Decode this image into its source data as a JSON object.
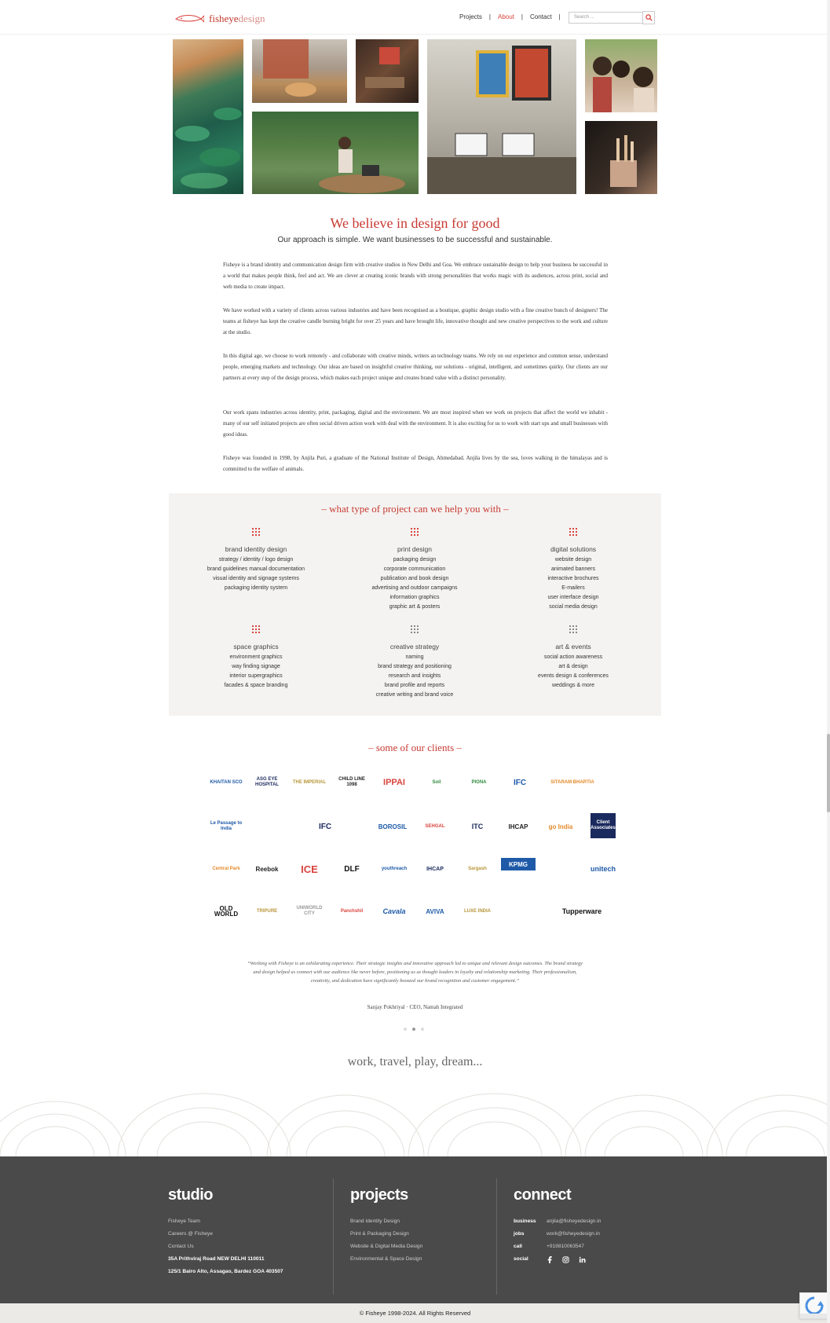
{
  "header": {
    "logo_bold": "fisheye",
    "logo_light": "design",
    "nav": [
      "Projects",
      "About",
      "Contact"
    ],
    "active_nav": "About",
    "search_placeholder": "Search ..."
  },
  "intro": {
    "headline": "We believe in design for good",
    "subhead": "Our approach is simple. We want businesses to be successful and sustainable.",
    "paragraphs": [
      "Fisheye is a brand identity and communication design firm with creative studios in New Delhi and Goa. We embrace sustainable design to help your business be successful in a world that makes people think, feel and act. We are clever at creating iconic brands with strong personalities that works magic with its audiences, across print, social and web media to create impact.",
      "We have worked with a variety of clients across various industries and have been recognised as a boutique, graphic design studio with a fine creative bunch of designers! The teams at fisheye has kept the creative candle burning bright for over 25 years and have brought life, innovative thought and new creative perspectives to the work and culture at the studio.",
      "In this digital age, we choose to work remotely - and collaborate with creative minds, writers an technology teams. We rely on our experience and common sense, understand people, emerging markets and technology. Our ideas are based on insightful creative thinking, our solutions - original, intelligent, and sometimes quirky. Our clients are our partners at every step of the design process, which makes each project unique and creates brand value with a distinct personality.",
      "Our work spans industries across identity, print, packaging, digital and the environment. We are most inspired when we work on projects that affect the world we inhabit - many of our self initiated projects are often social driven action work with deal with the environment. It is also exciting for us to work with start ups and small businesses with good ideas.",
      "Fisheye was founded in 1998, by Anjila Puri, a graduate of the National Institute of Design, Ahmedabad. Anjila lives by the sea, loves walking in the himalayas and is committed to the welfare of animals."
    ]
  },
  "services": {
    "title": "– what type of project can we help you with –",
    "items": [
      {
        "title": "brand identity design",
        "lines": [
          "strategy / identity / logo design",
          "brand guidelines manual documentation",
          "visual identity and signage systems",
          "packaging identity system"
        ]
      },
      {
        "title": "print design",
        "lines": [
          "packaging design",
          "corporate communication",
          "publication and book design",
          "advertising and outdoor campaigns",
          "information graphics",
          "graphic art & posters"
        ]
      },
      {
        "title": "digital solutions",
        "lines": [
          "website design",
          "animated banners",
          "interactive brochures",
          "E-mailers",
          "user interface design",
          "social media design"
        ]
      },
      {
        "title": "space graphics",
        "lines": [
          "environment graphics",
          "way finding signage",
          "interior supergraphics",
          "facades & space branding"
        ]
      },
      {
        "title": "creative strategy",
        "lines": [
          "naming",
          "brand strategy and positioning",
          "research and insights",
          "brand profile and reports",
          "creative writing and brand voice"
        ]
      },
      {
        "title": "art & events",
        "lines": [
          "social action awareness",
          "art & design",
          "events design & conferences",
          "weddings & more"
        ]
      }
    ]
  },
  "clients": {
    "title": "– some of our clients –",
    "logos": [
      [
        "KHAITAN SCO",
        "ASG EYE HOSPITAL",
        "THE IMPERIAL",
        "CHILD LINE 1098",
        "IPPAI",
        "Soil",
        "PIONA",
        "IFC",
        "SITARAM BHARTIA"
      ],
      [
        "Le Passage to India",
        "",
        "IFC",
        "BOROSIL",
        "SEHGAL",
        "ITC",
        "IHCAP",
        "go India",
        "Client Associates"
      ],
      [
        "Central Park",
        "Reebok",
        "ICE",
        "DLF",
        "youthreach",
        "IHCAP",
        "Sargash",
        "KPMG",
        "",
        "unitech"
      ],
      [
        "OLD WORLD",
        "TRIPURE",
        "UNIWORLD CITY",
        "Panchshil",
        "Cavala",
        "AVIVA",
        "LUXE INDIA",
        "",
        "Tupperware"
      ]
    ],
    "logo_colors": {
      "red": "#d9433c",
      "blue": "#1e5aa8",
      "navy": "#1b2a5e",
      "dark": "#222222",
      "orange": "#e58a2b",
      "green": "#2f8a3c",
      "gold": "#b8963a"
    }
  },
  "testimonial": {
    "quote": "“Working with Fisheye is an exhilarating experience. Their strategic insights and innovative approach led to unique and relevant design outcomes. The brand strategy and design helped us connect with our audience like never before, positioning us as thought leaders in loyalty and relationship marketing. Their professionalism, creativity, and dedication have significantly boosted our brand recognition and customer engagement.”",
    "author": "Sanjay Pokhriyal · CEO, Namah Integrated",
    "active_slide": 2
  },
  "tagline": "work, travel, play, dream...",
  "footer": {
    "studio": {
      "heading": "studio",
      "links": [
        "Fisheye Team",
        "Careers @ Fisheye",
        "Contact Us"
      ],
      "address1": "35A Prithviraj Road NEW DELHI 110011",
      "address2": "125/1 Bairo Alto, Assagao, Bardez GOA 403507"
    },
    "projects": {
      "heading": "projects",
      "links": [
        "Brand Identity Design",
        "Print & Packaging Design",
        "Website & Digital Media Design",
        "Environmental & Space Design"
      ]
    },
    "connect": {
      "heading": "connect",
      "rows": [
        {
          "k": "business",
          "v": "anjila@fisheyedesign.in"
        },
        {
          "k": "jobs",
          "v": "work@fisheyedesign.in"
        },
        {
          "k": "call",
          "v": "+919810063547"
        },
        {
          "k": "social",
          "v": ""
        }
      ],
      "social_icons": [
        "facebook-icon",
        "instagram-icon",
        "linkedin-icon"
      ]
    },
    "copyright": "© Fisheye 1998-2024. All Rights Reserved"
  },
  "colors": {
    "accent": "#c83a33",
    "footer_bg": "#4a4a4a",
    "services_bg": "#f4f3f1"
  }
}
